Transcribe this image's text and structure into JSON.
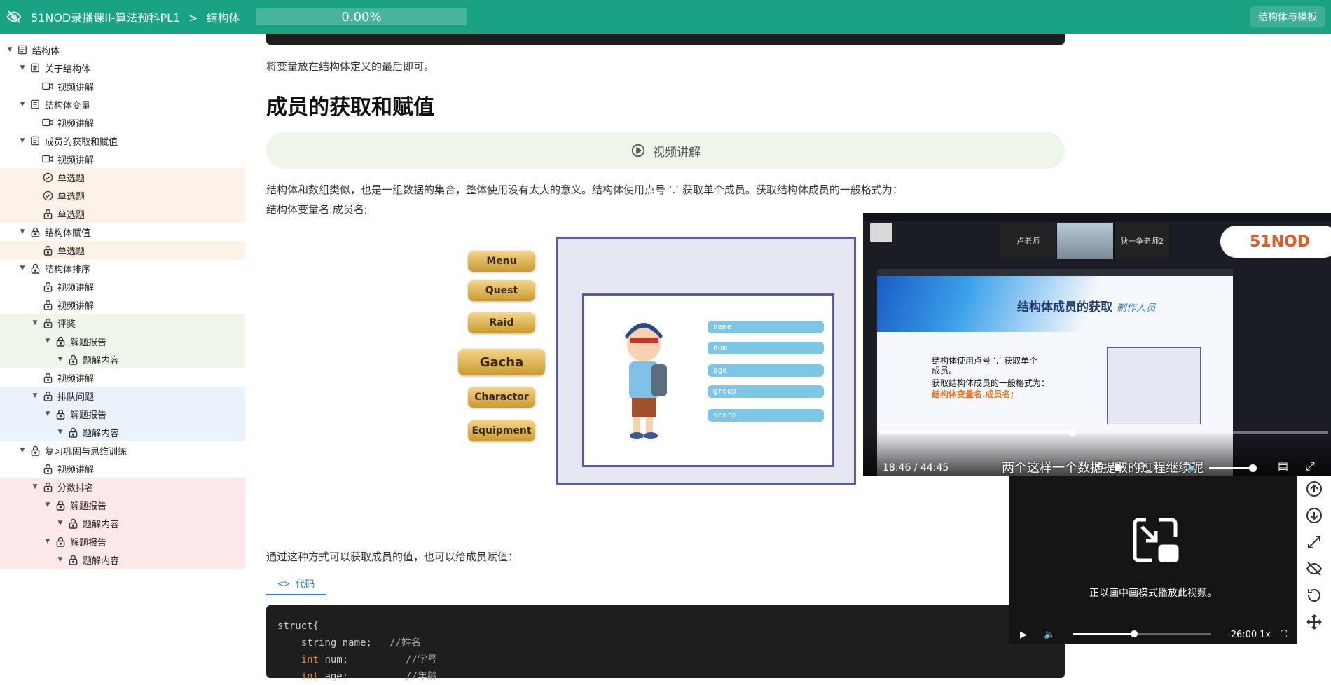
{
  "header": {
    "course": "51NOD录播课II-算法预科PL1",
    "separator": ">",
    "current": "结构体",
    "progress": "0.00%",
    "right_button": "结构体与模板"
  },
  "sidebar": [
    {
      "label": "结构体",
      "level": 0,
      "icon": "doc-icon",
      "caret": true,
      "bg": ""
    },
    {
      "label": "关于结构体",
      "level": 1,
      "icon": "doc-icon",
      "caret": true,
      "bg": ""
    },
    {
      "label": "视频讲解",
      "level": 2,
      "icon": "video-icon",
      "caret": false,
      "bg": ""
    },
    {
      "label": "结构体变量",
      "level": 1,
      "icon": "doc-icon",
      "caret": true,
      "bg": ""
    },
    {
      "label": "视频讲解",
      "level": 2,
      "icon": "video-icon",
      "caret": false,
      "bg": ""
    },
    {
      "label": "成员的获取和赋值",
      "level": 1,
      "icon": "doc-icon",
      "caret": true,
      "bg": ""
    },
    {
      "label": "视频讲解",
      "level": 2,
      "icon": "video-icon",
      "caret": false,
      "bg": ""
    },
    {
      "label": "单选题",
      "level": 2,
      "icon": "check-icon",
      "caret": false,
      "bg": "orange"
    },
    {
      "label": "单选题",
      "level": 2,
      "icon": "check-icon",
      "caret": false,
      "bg": "orange"
    },
    {
      "label": "单选题",
      "level": 2,
      "icon": "lock-icon",
      "caret": false,
      "bg": "orange"
    },
    {
      "label": "结构体赋值",
      "level": 1,
      "icon": "lock-icon",
      "caret": true,
      "bg": ""
    },
    {
      "label": "单选题",
      "level": 2,
      "icon": "lock-icon",
      "caret": false,
      "bg": "orange"
    },
    {
      "label": "结构体排序",
      "level": 1,
      "icon": "lock-icon",
      "caret": true,
      "bg": ""
    },
    {
      "label": "视频讲解",
      "level": 2,
      "icon": "lock-icon",
      "caret": false,
      "bg": ""
    },
    {
      "label": "视频讲解",
      "level": 2,
      "icon": "lock-icon",
      "caret": false,
      "bg": ""
    },
    {
      "label": "评奖",
      "level": 2,
      "icon": "lock-icon",
      "caret": true,
      "bg": "green"
    },
    {
      "label": "解题报告",
      "level": 3,
      "icon": "lock-icon",
      "caret": true,
      "bg": "green"
    },
    {
      "label": "题解内容",
      "level": 4,
      "icon": "lock-icon",
      "caret": true,
      "bg": "green"
    },
    {
      "label": "视频讲解",
      "level": 2,
      "icon": "lock-icon",
      "caret": false,
      "bg": ""
    },
    {
      "label": "排队问题",
      "level": 2,
      "icon": "lock-icon",
      "caret": true,
      "bg": "blue"
    },
    {
      "label": "解题报告",
      "level": 3,
      "icon": "lock-icon",
      "caret": true,
      "bg": "blue"
    },
    {
      "label": "题解内容",
      "level": 4,
      "icon": "lock-icon",
      "caret": true,
      "bg": "blue"
    },
    {
      "label": "复习巩固与思维训练",
      "level": 1,
      "icon": "lock-icon",
      "caret": true,
      "bg": ""
    },
    {
      "label": "视频讲解",
      "level": 2,
      "icon": "lock-icon",
      "caret": false,
      "bg": ""
    },
    {
      "label": "分数排名",
      "level": 2,
      "icon": "lock-icon",
      "caret": true,
      "bg": "pink"
    },
    {
      "label": "解题报告",
      "level": 3,
      "icon": "lock-icon",
      "caret": true,
      "bg": "pink"
    },
    {
      "label": "题解内容",
      "level": 4,
      "icon": "lock-icon",
      "caret": true,
      "bg": "pink"
    },
    {
      "label": "解题报告",
      "level": 3,
      "icon": "lock-icon",
      "caret": true,
      "bg": "pink"
    },
    {
      "label": "题解内容",
      "level": 4,
      "icon": "lock-icon",
      "caret": true,
      "bg": "pink"
    }
  ],
  "content": {
    "intro": "将变量放在结构体定义的最后即可。",
    "heading": "成员的获取和赋值",
    "video_button": "视频讲解",
    "para1": "结构体和数组类似，也是一组数据的集合，整体使用没有太大的意义。结构体使用点号 ‘.’ 获取单个成员。获取结构体成员的一般格式为：",
    "para2": "结构体变量名.成员名;",
    "para3": "通过这种方式可以获取成员的值，也可以给成员赋值：",
    "code_tab": "代码",
    "illus_menu": [
      "Menu",
      "Quest",
      "Raid",
      "Gacha",
      "Charactor",
      "Equipment"
    ],
    "illus_fields": [
      "name",
      "num",
      "age",
      "group",
      "score"
    ],
    "code_lines": [
      {
        "text": "struct{",
        "comment": ""
      },
      {
        "kw": "",
        "text": "    string name;",
        "comment": "//姓名"
      },
      {
        "kw": "int",
        "text": " num;",
        "comment": "//学号"
      },
      {
        "kw": "int",
        "text": " age;",
        "comment": "//年龄"
      }
    ]
  },
  "video": {
    "cam1": "卢老师",
    "cam3": "狄一争老师2",
    "logo": "51NOD",
    "slide_title": "结构体成员的获取",
    "slide_title_sig": "制作人员",
    "slide_line1": "结构体使用点号 ‘.’ 获取单个",
    "slide_line2": "成员。",
    "slide_line3": "获取结构体成员的一般格式为：",
    "slide_line4": "结构体变量名.成员名;",
    "time": "18:46 / 44:45",
    "subtitle": "两个这样一个数据提取的过程继续呢",
    "progress_fraction": 0.42,
    "volume_fraction": 0.95
  },
  "pip": {
    "message": "正以画中画模式播放此视频。",
    "remaining": "-26:00",
    "speed": "1x",
    "progress_fraction": 0.42
  },
  "colors": {
    "brand": "#1aa383",
    "link": "#2a7ed4"
  }
}
